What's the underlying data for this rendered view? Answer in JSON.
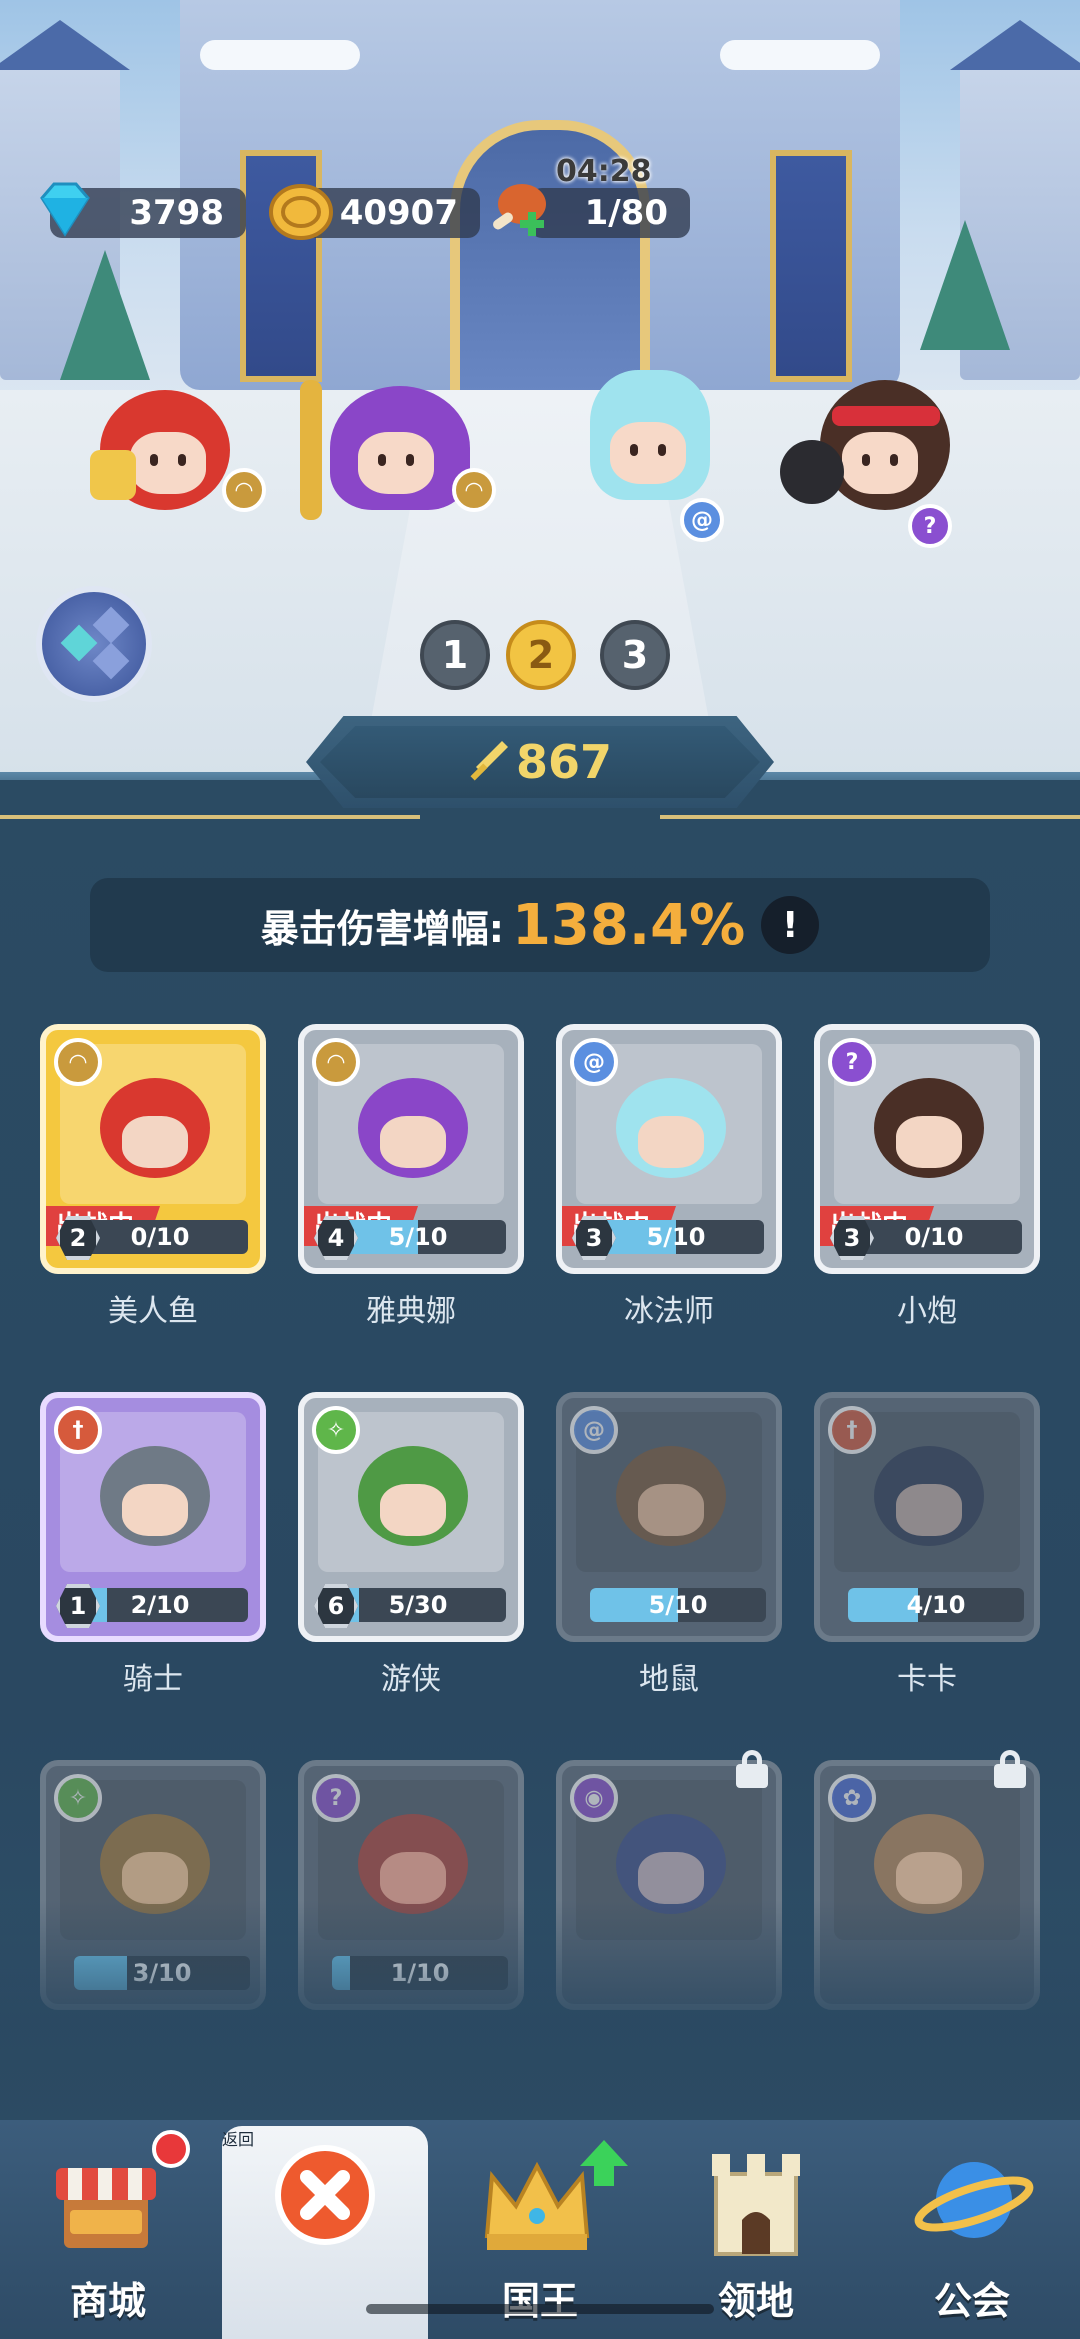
{
  "resources": {
    "gems": "3798",
    "coins": "40907",
    "stamina": "1/80",
    "stamina_timer": "04:28"
  },
  "team_pages": [
    "1",
    "2",
    "3"
  ],
  "active_team_page": "2",
  "power": "867",
  "crit_bonus": {
    "label": "暴击伤害增幅:",
    "value": "138.4%",
    "info": "!"
  },
  "deployed_tag": "出战中",
  "heroes": [
    {
      "name": "美人鱼",
      "level": "2",
      "progress": "0/10",
      "progress_fraction": 0,
      "deployed": true,
      "rarity": "gold",
      "class_icon": "wings-icon",
      "class_color": "#c99a3d"
    },
    {
      "name": "雅典娜",
      "level": "4",
      "progress": "5/10",
      "progress_fraction": 0.5,
      "deployed": true,
      "rarity": "silver",
      "class_icon": "wings-icon",
      "class_color": "#c99a3d"
    },
    {
      "name": "冰法师",
      "level": "3",
      "progress": "5/10",
      "progress_fraction": 0.5,
      "deployed": true,
      "rarity": "silver",
      "class_icon": "spiral-icon",
      "class_color": "#5b8fe0"
    },
    {
      "name": "小炮",
      "level": "3",
      "progress": "0/10",
      "progress_fraction": 0,
      "deployed": true,
      "rarity": "silver",
      "class_icon": "magic-wand-icon",
      "class_color": "#8a4fd0"
    },
    {
      "name": "骑士",
      "level": "1",
      "progress": "2/10",
      "progress_fraction": 0.2,
      "deployed": false,
      "rarity": "purple",
      "class_icon": "sword-icon",
      "class_color": "#d65a3c"
    },
    {
      "name": "游侠",
      "level": "6",
      "progress": "5/30",
      "progress_fraction": 0.1667,
      "deployed": false,
      "rarity": "silver",
      "class_icon": "bow-icon",
      "class_color": "#5fb64a"
    },
    {
      "name": "地鼠",
      "level": "",
      "progress": "5/10",
      "progress_fraction": 0.5,
      "deployed": false,
      "rarity": "locked",
      "class_icon": "spiral-icon",
      "class_color": "#5b8fe0"
    },
    {
      "name": "卡卡",
      "level": "",
      "progress": "4/10",
      "progress_fraction": 0.4,
      "deployed": false,
      "rarity": "locked",
      "class_icon": "sword-icon",
      "class_color": "#d65a3c"
    },
    {
      "name": "",
      "level": "",
      "progress": "3/10",
      "progress_fraction": 0.3,
      "deployed": false,
      "rarity": "locked",
      "class_icon": "bow-icon",
      "class_color": "#5fb64a"
    },
    {
      "name": "",
      "level": "",
      "progress": "1/10",
      "progress_fraction": 0.1,
      "deployed": false,
      "rarity": "locked",
      "class_icon": "magic-wand-icon",
      "class_color": "#8a4fd0"
    },
    {
      "name": "",
      "level": "",
      "progress": "",
      "progress_fraction": 0,
      "deployed": false,
      "rarity": "locked",
      "class_icon": "eye-icon",
      "class_color": "#8a4fd0",
      "padlock": true
    },
    {
      "name": "",
      "level": "",
      "progress": "",
      "progress_fraction": 0,
      "deployed": false,
      "rarity": "locked",
      "class_icon": "paw-icon",
      "class_color": "#4a6bd8",
      "padlock": true
    }
  ],
  "nav": [
    {
      "label": "商城",
      "icon": "shop-icon",
      "badge": true
    },
    {
      "label": "返回",
      "icon": "close-icon",
      "active": true
    },
    {
      "label": "国王",
      "icon": "crown-icon",
      "upgrade": true
    },
    {
      "label": "领地",
      "icon": "castle-icon"
    },
    {
      "label": "公会",
      "icon": "planet-icon"
    }
  ],
  "colors": {
    "accent_gold": "#f4ae3d",
    "power_gold": "#f2d56a",
    "panel": "#2b4b63",
    "deployed_red": "#e0413f"
  }
}
